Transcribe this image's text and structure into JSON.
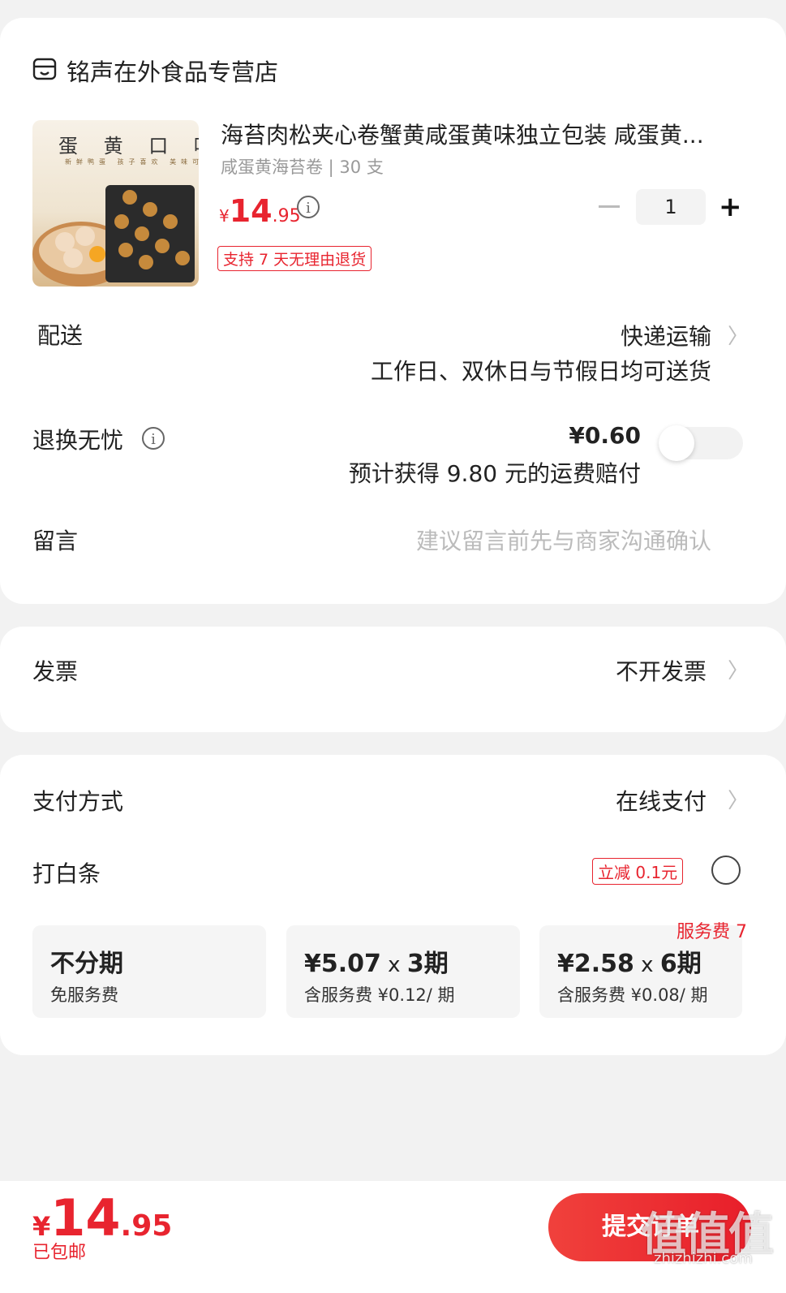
{
  "store": {
    "name": "铭声在外食品专营店",
    "icon": "store-icon"
  },
  "product": {
    "image_text": "蛋 黄 口 味",
    "image_subtext": "新鲜鸭蛋  孩子喜欢  美味可口",
    "title": "海苔肉松夹心卷蟹黄咸蛋黄味独立包装 咸蛋黄...",
    "spec": "咸蛋黄海苔卷 | 30 支",
    "price_currency": "¥",
    "price_int": "14",
    "price_dec": ".95",
    "quantity": "1",
    "return_policy": "支持 7 天无理由退货"
  },
  "delivery": {
    "label": "配送",
    "method": "快递运输",
    "note": "工作日、双休日与节假日均可送货"
  },
  "return_insurance": {
    "label": "退换无忧",
    "price": "¥0.60",
    "note": "预计获得 9.80 元的运费赔付",
    "enabled": false
  },
  "message": {
    "label": "留言",
    "placeholder": "建议留言前先与商家沟通确认"
  },
  "invoice": {
    "label": "发票",
    "value": "不开发票"
  },
  "payment": {
    "label": "支付方式",
    "value": "在线支付"
  },
  "baitiao": {
    "label": "打白条",
    "discount": "立减 0.1元",
    "selected": false,
    "fee_tag": "服务费 7",
    "options": [
      {
        "main": "不分期",
        "times": "",
        "sub": "免服务费"
      },
      {
        "main": "¥5.07",
        "times": "3期",
        "sub": "含服务费 ¥0.12/ 期"
      },
      {
        "main": "¥2.58",
        "times": "6期",
        "sub": "含服务费 ¥0.08/ 期"
      }
    ]
  },
  "footer": {
    "total_currency": "¥",
    "total_int": "14",
    "total_dec": ".95",
    "shipping_note": "已包邮",
    "submit_label": "提交订单",
    "watermark": "值值值",
    "watermark_url": "zhizhizhi.com"
  },
  "colors": {
    "accent": "#e8242f",
    "background": "#f2f2f2",
    "card": "#ffffff"
  }
}
